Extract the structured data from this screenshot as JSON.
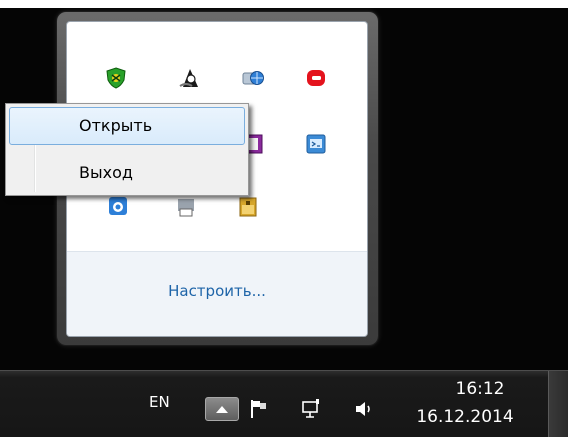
{
  "context_menu": {
    "items": [
      {
        "label": "Открыть",
        "highlighted": true
      },
      {
        "label": "Выход",
        "highlighted": false
      }
    ]
  },
  "flyout": {
    "customize_label": "Настроить...",
    "icons": [
      "shield-bug-icon",
      "diver-app-icon",
      "network-globe-icon",
      "red-app-icon",
      "purple-window-icon",
      "blue-window-icon",
      "blue-shield-icon",
      "printer-icon",
      "yellow-folder-icon"
    ]
  },
  "taskbar": {
    "language": "EN",
    "time": "16:12",
    "date": "16.12.2014",
    "icons": [
      "show-hidden-icons-icon",
      "action-center-flag-icon",
      "network-icon",
      "volume-icon"
    ]
  },
  "colors": {
    "link": "#1e64a8",
    "menu_highlight_border": "#7aaede",
    "taskbar": "#161616"
  }
}
